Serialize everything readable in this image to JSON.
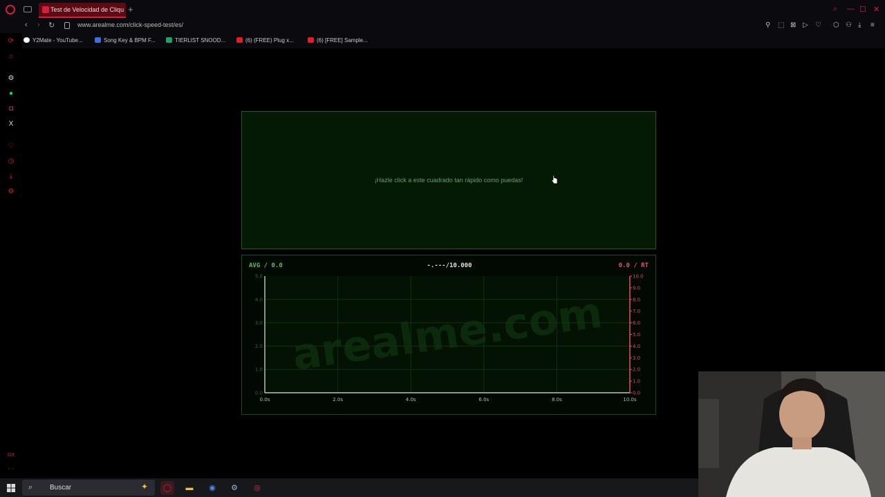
{
  "browser": {
    "tab_title": "Test de Velocidad de Cliqu",
    "new_tab_symbol": "+",
    "url": "www.arealme.com/click-speed-test/es/",
    "bookmarks": [
      {
        "label": "Y2Mate - YouTube...",
        "color": "#ffffff"
      },
      {
        "label": "Song Key & BPM F...",
        "color": "#3b6ee0"
      },
      {
        "label": "TIERLIST SNOOD...",
        "color": "#1fa463"
      },
      {
        "label": "(6) (FREE) Plug x...",
        "color": "#e01e2b"
      },
      {
        "label": "(6) [FREE] Sample...",
        "color": "#e01e2b"
      }
    ]
  },
  "page": {
    "click_prompt": "¡Hazle click a este cuadrado tan rápido como puedas!",
    "avg_label": "AVG / 0.0",
    "timer_label": "-.---/10.000",
    "rt_label": "0.0 / RT",
    "watermark": "arealme.com"
  },
  "chart_data": {
    "type": "line",
    "x_ticks": [
      "0.0s",
      "2.0s",
      "4.0s",
      "6.0s",
      "8.0s",
      "10.0s"
    ],
    "y_left_ticks": [
      "0.0",
      "1.0",
      "2.0",
      "3.0",
      "4.0",
      "5.0"
    ],
    "y_right_ticks": [
      "0.0",
      "1.0",
      "2.0",
      "3.0",
      "4.0",
      "5.0",
      "6.0",
      "7.0",
      "8.0",
      "9.0",
      "10.0"
    ],
    "xlim": [
      0,
      10
    ],
    "ylim_left": [
      0,
      5
    ],
    "ylim_right": [
      0,
      10
    ],
    "series": [],
    "grid": true,
    "colors": {
      "left_axis": "#e8e8e8",
      "right_axis": "#e8506a",
      "grid": "#153015",
      "left_text": "#2f6a2f",
      "right_text": "#d9506a"
    }
  },
  "taskbar": {
    "search_placeholder": "Buscar"
  }
}
